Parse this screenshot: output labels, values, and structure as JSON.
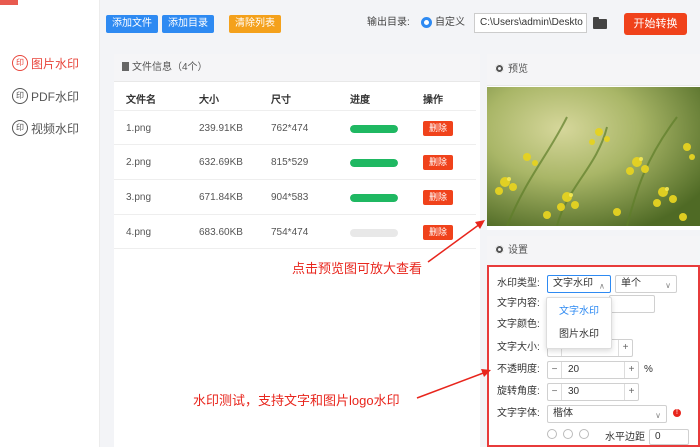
{
  "colors": {
    "accent": "#2e8af2",
    "danger": "#f0421b",
    "warning": "#f4a11c",
    "progress": "#1fb862",
    "annotation": "#e8251c"
  },
  "sidebar": {
    "items": [
      {
        "label": "图片水印",
        "icon": "watermark-icon",
        "active": true
      },
      {
        "label": "PDF水印",
        "icon": "watermark-icon",
        "active": false
      },
      {
        "label": "视频水印",
        "icon": "watermark-icon",
        "active": false
      }
    ],
    "icon_glyph": "印"
  },
  "toolbar": {
    "add_file": "添加文件",
    "add_dir": "添加目录",
    "clear_list": "清除列表",
    "output_label": "输出目录:",
    "custom_label": "自定义",
    "output_path": "C:\\Users\\admin\\Deskto",
    "start": "开始转换"
  },
  "file_panel": {
    "title": "文件信息（4个）",
    "columns": [
      "文件名",
      "大小",
      "尺寸",
      "进度",
      "操作"
    ],
    "delete_label": "删除",
    "rows": [
      {
        "name": "1.png",
        "size": "239.91KB",
        "dims": "762*474",
        "progress": 1.0
      },
      {
        "name": "2.png",
        "size": "632.69KB",
        "dims": "815*529",
        "progress": 1.0
      },
      {
        "name": "3.png",
        "size": "671.84KB",
        "dims": "904*583",
        "progress": 1.0
      },
      {
        "name": "4.png",
        "size": "683.60KB",
        "dims": "754*474",
        "progress": 0.0
      }
    ]
  },
  "preview": {
    "title": "预览"
  },
  "settings": {
    "title": "设置",
    "type_label": "水印类型:",
    "type_value": "文字水印",
    "mode_value": "单个",
    "content_label": "文字内容:",
    "color_label": "文字颜色:",
    "size_label": "文字大小:",
    "opacity_label": "不透明度:",
    "opacity_value": "20",
    "opacity_unit": "%",
    "rotation_label": "旋转角度:",
    "rotation_value": "30",
    "font_label": "文字字体:",
    "font_value": "楷体",
    "hmargin_label": "水平边距",
    "hmargin_value": "0",
    "dropdown_options": [
      "文字水印",
      "图片水印"
    ],
    "chev": "∨",
    "minus": "−",
    "plus": "+",
    "warn": "!"
  },
  "annotations": {
    "preview_note": "点击预览图可放大查看",
    "watermark_note": "水印测试，支持文字和图片logo水印"
  }
}
